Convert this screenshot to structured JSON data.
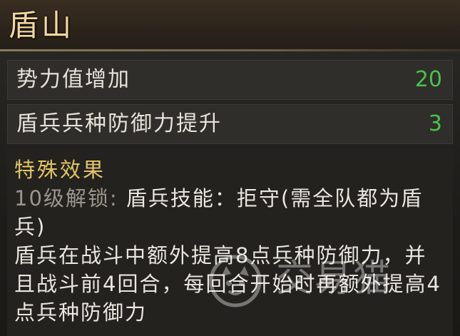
{
  "title": "盾山",
  "stats": [
    {
      "label": "势力值增加",
      "value": "20"
    },
    {
      "label": "盾兵兵种防御力提升",
      "value": "3"
    }
  ],
  "special_effects": {
    "heading": "特殊效果",
    "unlock_prefix": "10级解锁:",
    "unlock_text": " 盾兵技能：拒守(需全队都为盾兵)",
    "description": "盾兵在战斗中额外提高8点兵种防御力，并且战斗前4回合，每回合开始时再额外提高4点兵种防御力"
  },
  "watermark": {
    "text": "交易猫",
    "icon": "cat-logo-icon"
  },
  "colors": {
    "title": "#f2d6a0",
    "value_green": "#49c24a",
    "heading_gold": "#e3c565",
    "unlock_gray": "#9a968d"
  }
}
